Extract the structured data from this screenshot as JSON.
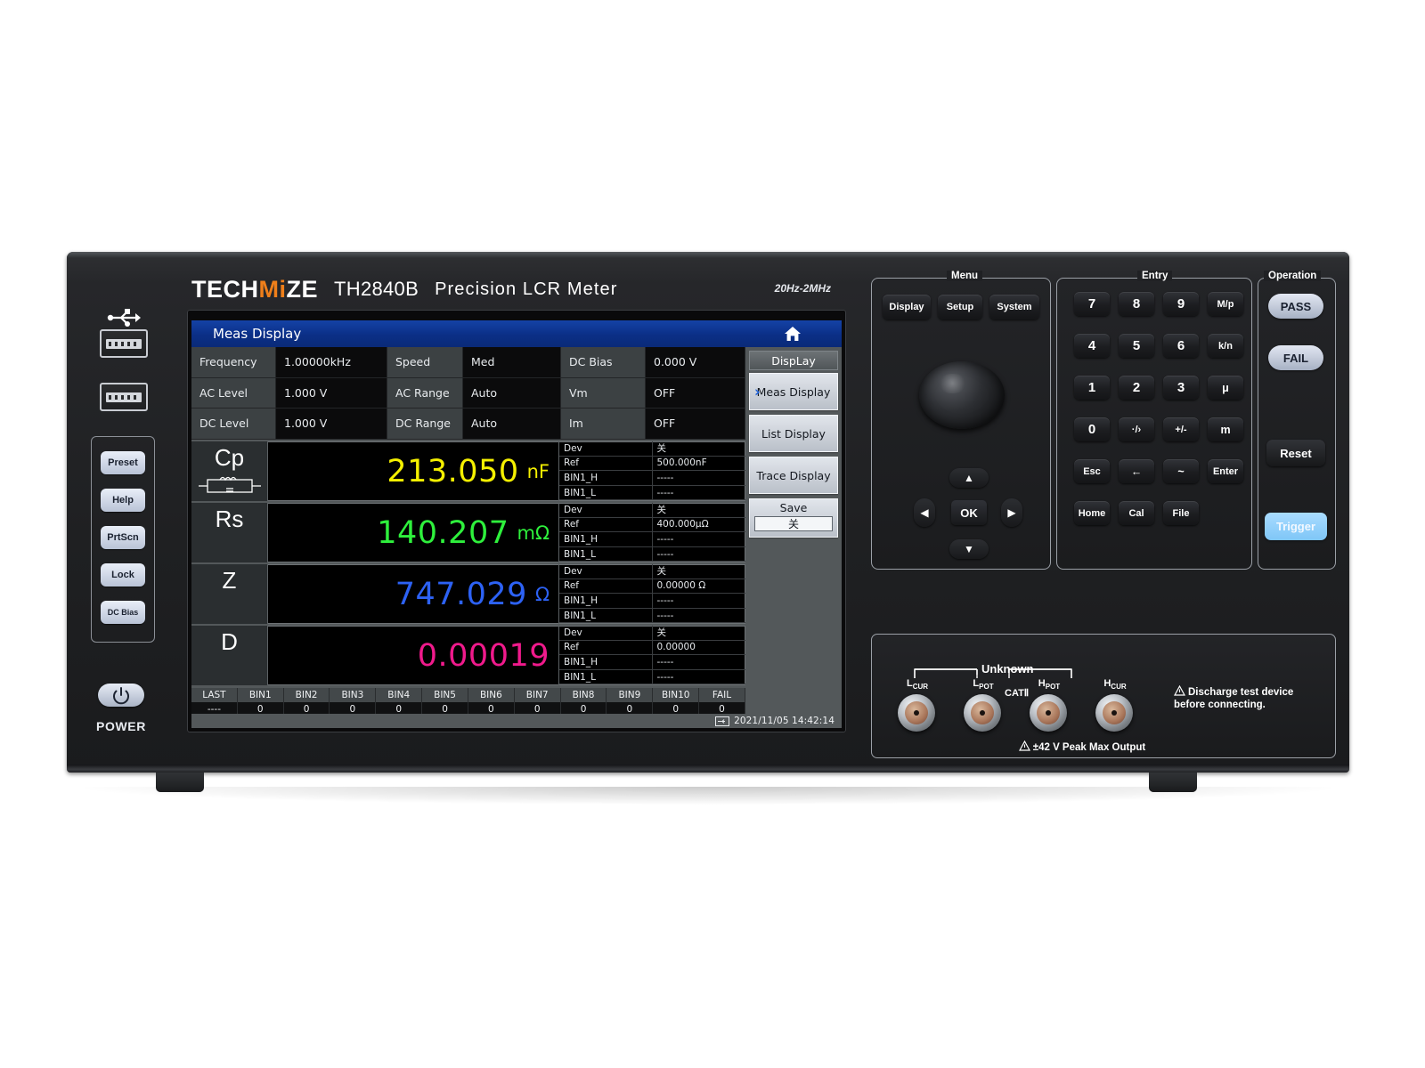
{
  "brand": {
    "name_part1": "TECH",
    "name_mi": "Mi",
    "name_part2": "ZE",
    "model": "TH2840B",
    "description": "Precision  LCR  Meter",
    "range": "20Hz-2MHz"
  },
  "screen": {
    "title": "Meas Display",
    "home_icon": "home-icon",
    "params": [
      {
        "l1": "Frequency",
        "v1": "1.00000kHz",
        "l2": "Speed",
        "v2": "Med",
        "l3": "DC Bias",
        "v3": "0.000 V"
      },
      {
        "l1": "AC Level",
        "v1": "1.000 V",
        "l2": "AC Range",
        "v2": "Auto",
        "l3": "Vm",
        "v3": "OFF"
      },
      {
        "l1": "DC Level",
        "v1": "1.000 V",
        "l2": "DC Range",
        "v2": "Auto",
        "l3": "Im",
        "v3": "OFF"
      }
    ],
    "measurements": [
      {
        "symbol": "Cp",
        "has_circuit_icon": true,
        "value": "213.050",
        "unit": "nF",
        "color": "#f5f000",
        "keys": [
          "Dev",
          "Ref",
          "BIN1_H",
          "BIN1_L"
        ],
        "vals": [
          "关",
          "500.000nF",
          "-----",
          "-----"
        ]
      },
      {
        "symbol": "Rs",
        "has_circuit_icon": false,
        "value": "140.207",
        "unit": "mΩ",
        "color": "#2ef03c",
        "keys": [
          "Dev",
          "Ref",
          "BIN1_H",
          "BIN1_L"
        ],
        "vals": [
          "关",
          "400.000μΩ",
          "-----",
          "-----"
        ]
      },
      {
        "symbol": "Z",
        "has_circuit_icon": false,
        "value": "747.029",
        "unit": "Ω",
        "color": "#2d62f5",
        "keys": [
          "Dev",
          "Ref",
          "BIN1_H",
          "BIN1_L"
        ],
        "vals": [
          "关",
          "0.00000 Ω",
          "-----",
          "-----"
        ]
      },
      {
        "symbol": "D",
        "has_circuit_icon": false,
        "value": "0.00019",
        "unit": "",
        "color": "#f01a8c",
        "keys": [
          "Dev",
          "Ref",
          "BIN1_H",
          "BIN1_L"
        ],
        "vals": [
          "关",
          "0.00000",
          "-----",
          "-----"
        ]
      }
    ],
    "bins": {
      "headers": [
        "LAST",
        "BIN1",
        "BIN2",
        "BIN3",
        "BIN4",
        "BIN5",
        "BIN6",
        "BIN7",
        "BIN8",
        "BIN9",
        "BIN10",
        "FAIL"
      ],
      "values": [
        "----",
        "0",
        "0",
        "0",
        "0",
        "0",
        "0",
        "0",
        "0",
        "0",
        "0",
        "0"
      ]
    },
    "softkeys": {
      "header": "DispLay",
      "items": [
        {
          "label": "Meas Display",
          "selected": true
        },
        {
          "label": "List Display",
          "selected": false
        },
        {
          "label": "Trace Display",
          "selected": false
        }
      ],
      "save": {
        "label": "Save",
        "value": "关"
      }
    },
    "status": {
      "usb_icon": "usb-icon",
      "timestamp": "2021/11/05 14:42:14"
    }
  },
  "left_panel": {
    "usb_icon": "usb-icon",
    "ports": [
      "usb-port-top",
      "usb-port-bottom"
    ],
    "buttons": [
      {
        "label": "Preset"
      },
      {
        "label": "Help"
      },
      {
        "label": "PrtScn"
      },
      {
        "label": "Lock"
      },
      {
        "label": "DC Bias"
      }
    ],
    "power": {
      "icon": "power-icon",
      "label": "POWER"
    }
  },
  "menu_panel": {
    "title": "Menu",
    "buttons": [
      "Display",
      "Setup",
      "System"
    ],
    "knob": "rotary-knob",
    "dpad": {
      "up": "▲",
      "down": "▼",
      "left": "◀",
      "right": "▶",
      "ok": "OK"
    }
  },
  "entry_panel": {
    "title": "Entry",
    "keys": [
      [
        "7",
        "8",
        "9",
        "M/p"
      ],
      [
        "4",
        "5",
        "6",
        "k/n"
      ],
      [
        "1",
        "2",
        "3",
        "μ"
      ],
      [
        "0",
        "·/›",
        "+/-",
        "m"
      ],
      [
        "Esc",
        "←",
        "~",
        "Enter"
      ],
      [
        "Home",
        "Cal",
        "File"
      ]
    ]
  },
  "operation_panel": {
    "title": "Operation",
    "pass": "PASS",
    "fail": "FAIL",
    "reset": "Reset",
    "trigger": "Trigger",
    "trigger_color": "#8fcef5"
  },
  "terminals": {
    "group_label": "Unknown",
    "cat_label": "CATⅡ",
    "labels": [
      {
        "main": "L",
        "sub": "CUR"
      },
      {
        "main": "L",
        "sub": "POT"
      },
      {
        "main": "H",
        "sub": "POT"
      },
      {
        "main": "H",
        "sub": "CUR"
      }
    ],
    "warning_discharge": "Discharge test device before connecting.",
    "warning_voltage": "±42 V Peak Max Output"
  }
}
